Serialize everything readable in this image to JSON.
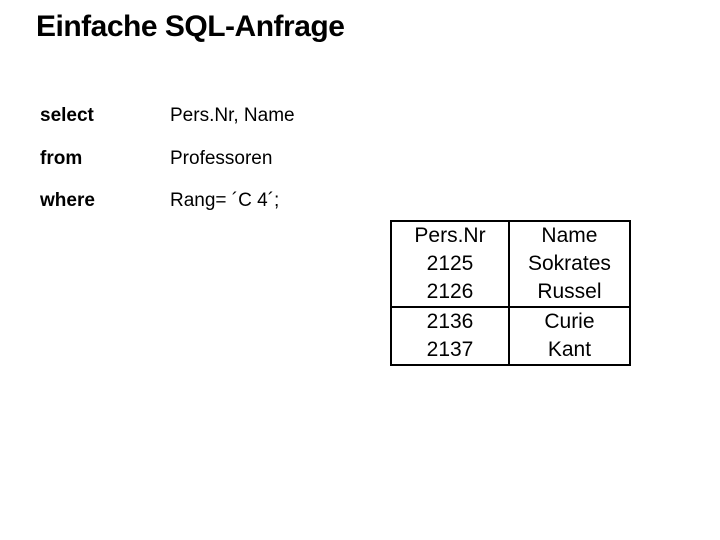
{
  "title": "Einfache SQL-Anfrage",
  "sql": {
    "rows": [
      {
        "kw": "select",
        "val": "Pers.Nr, Name"
      },
      {
        "kw": "from",
        "val": "Professoren"
      },
      {
        "kw": "where",
        "val": "Rang= ´C 4´;"
      }
    ]
  },
  "chart_data": {
    "type": "table",
    "columns": [
      "Pers.Nr",
      "Name"
    ],
    "groups": [
      {
        "rows": [
          [
            2125,
            "Sokrates"
          ],
          [
            2126,
            "Russel"
          ]
        ]
      },
      {
        "rows": [
          [
            2136,
            "Curie"
          ],
          [
            2137,
            "Kant"
          ]
        ]
      }
    ]
  }
}
